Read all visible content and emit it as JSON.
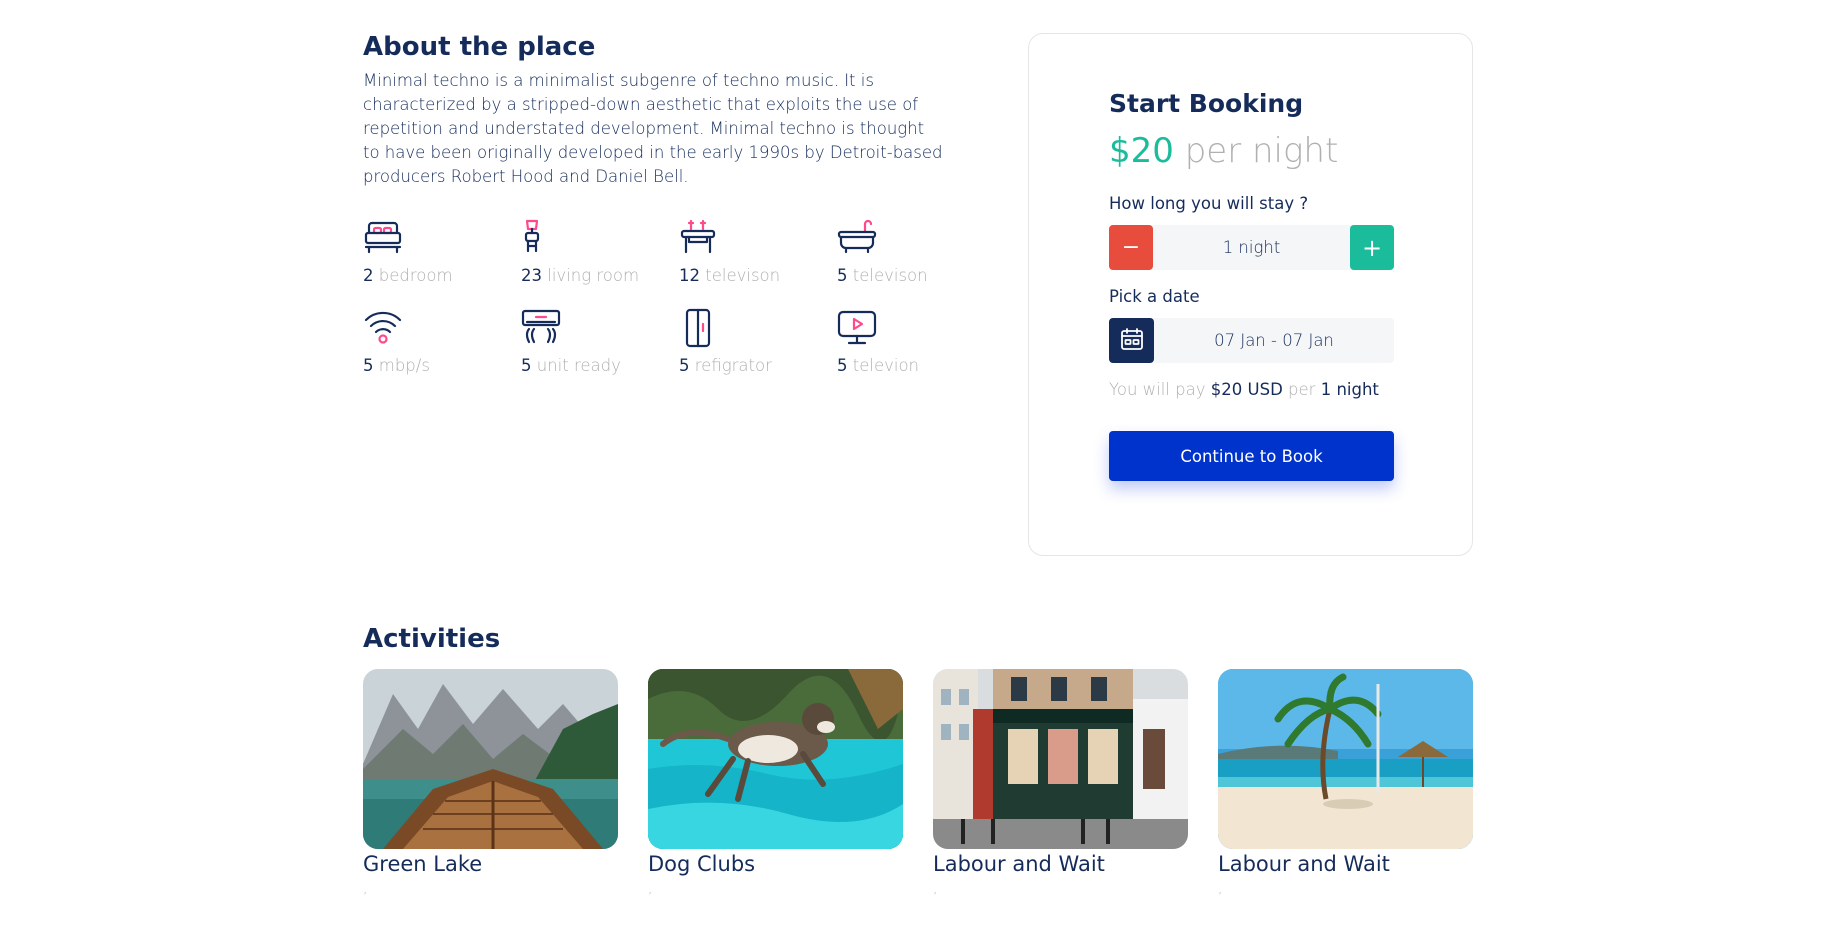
{
  "about": {
    "title": "About the place",
    "description": "Minimal techno is a minimalist subgenre of techno music. It is characterized by a stripped-down aesthetic that exploits the use of repetition and understated development. Minimal techno is thought to have been originally developed in the early 1990s by Detroit-based producers Robert Hood and Daniel Bell."
  },
  "features": [
    {
      "icon": "bed-icon",
      "count": "2",
      "label": "bedroom"
    },
    {
      "icon": "living-room-icon",
      "count": "23",
      "label": "living room"
    },
    {
      "icon": "dining-table-icon",
      "count": "12",
      "label": "televison"
    },
    {
      "icon": "bathtub-icon",
      "count": "5",
      "label": "televison"
    },
    {
      "icon": "wifi-icon",
      "count": "5",
      "label": "mbp/s"
    },
    {
      "icon": "air-conditioner-icon",
      "count": "5",
      "label": "unit ready"
    },
    {
      "icon": "refrigerator-icon",
      "count": "5",
      "label": "refigrator"
    },
    {
      "icon": "television-icon",
      "count": "5",
      "label": "televion"
    }
  ],
  "booking": {
    "title": "Start Booking",
    "price": "$20",
    "per_night": "per night",
    "stay_label": "How long you will stay ?",
    "minus": "−",
    "plus": "+",
    "duration": "1 night",
    "date_label": "Pick a date",
    "date_range": "07 Jan - 07 Jan",
    "pay_prefix": "You will pay",
    "pay_amount": "$20 USD",
    "pay_per": "per",
    "pay_nights": "1 night",
    "cta": "Continue to Book"
  },
  "activities": {
    "title": "Activities",
    "items": [
      {
        "name": "Green Lake",
        "sub": ","
      },
      {
        "name": "Dog Clubs",
        "sub": ","
      },
      {
        "name": "Labour and Wait",
        "sub": ","
      },
      {
        "name": "Labour and Wait",
        "sub": ","
      }
    ]
  },
  "colors": {
    "navy": "#152c5b",
    "teal": "#1abc9c",
    "red": "#e74c3c",
    "blue": "#0033cc",
    "gray": "#b0b0b0",
    "pink": "#ff498b"
  }
}
